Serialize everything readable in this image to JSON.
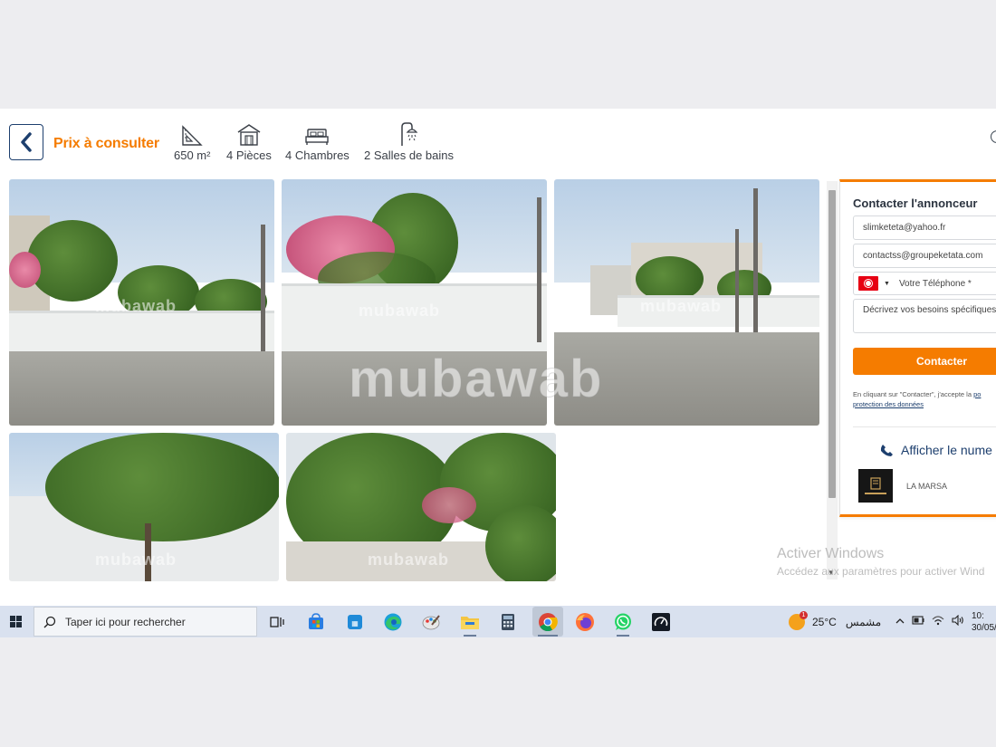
{
  "header": {
    "price": "Prix à consulter",
    "features": [
      {
        "icon": "area-icon",
        "label": "650 m²"
      },
      {
        "icon": "rooms-icon",
        "label": "4 Pièces"
      },
      {
        "icon": "bed-icon",
        "label": "4 Chambres"
      },
      {
        "icon": "shower-icon",
        "label": "2 Salles de bains"
      }
    ]
  },
  "gallery": {
    "watermark": "mubawab",
    "photo_count": 5
  },
  "contact": {
    "title": "Contacter l'annonceur",
    "email_value": "slimketeta@yahoo.fr",
    "email2_value": "contactss@groupeketata.com",
    "phone_placeholder": "Votre Téléphone *",
    "message_placeholder": "Décrivez vos besoins spécifiques",
    "button": "Contacter",
    "legal_text": "En cliquant sur \"Contacter\", j'accepte la ",
    "legal_link_a": "po",
    "legal_link_b": "protection des données",
    "show_number": "Afficher le nume",
    "agency_city": "LA MARSA"
  },
  "windows_activation": {
    "line1": "Activer Windows",
    "line2": "Accédez aux paramètres pour activer Wind"
  },
  "taskbar": {
    "search_placeholder": "Taper ici pour rechercher",
    "weather_badge": "1",
    "weather_temp": "25°C",
    "weather_text": "مشمس",
    "time": "10:",
    "date": "30/05/"
  },
  "colors": {
    "accent": "#f57c00",
    "navy": "#1d3f6e"
  }
}
